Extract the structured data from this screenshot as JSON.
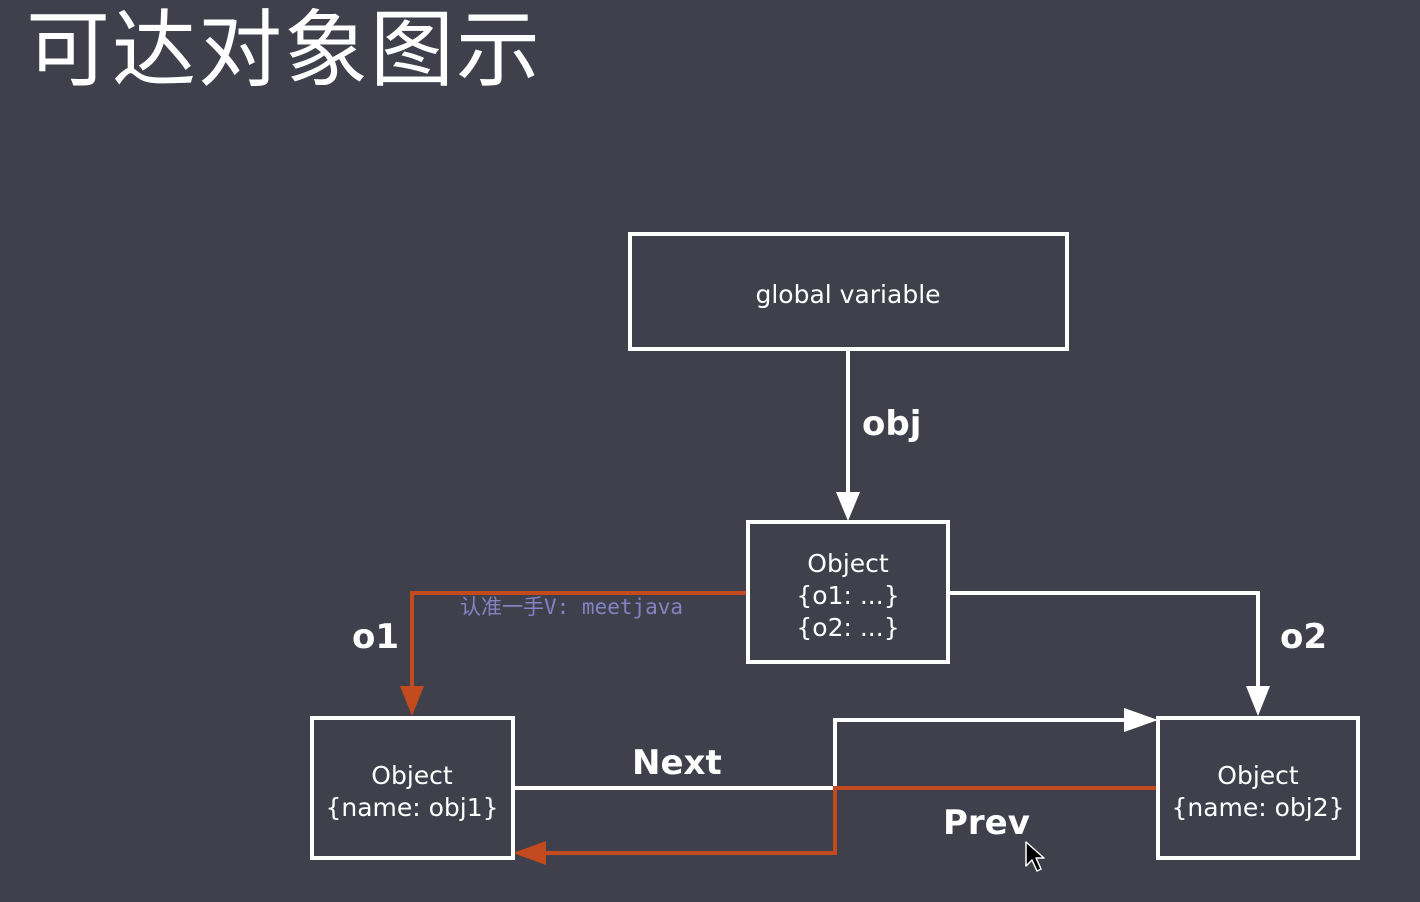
{
  "title": "可达对象图示",
  "nodes": {
    "global": {
      "label": "global variable"
    },
    "center": {
      "lines": [
        "Object",
        "{o1:  ...}",
        "{o2:  ...}"
      ]
    },
    "left": {
      "lines": [
        "Object",
        "{name: obj1}"
      ]
    },
    "right": {
      "lines": [
        "Object",
        "{name: obj2}"
      ]
    }
  },
  "edges": {
    "obj": "obj",
    "o1": "o1",
    "o2": "o2",
    "next": "Next",
    "prev": "Prev"
  },
  "watermark": "认准一手V: meetjava",
  "colors": {
    "background": "#3f404c",
    "line": "#ffffff",
    "highlight": "#c24a1e"
  }
}
